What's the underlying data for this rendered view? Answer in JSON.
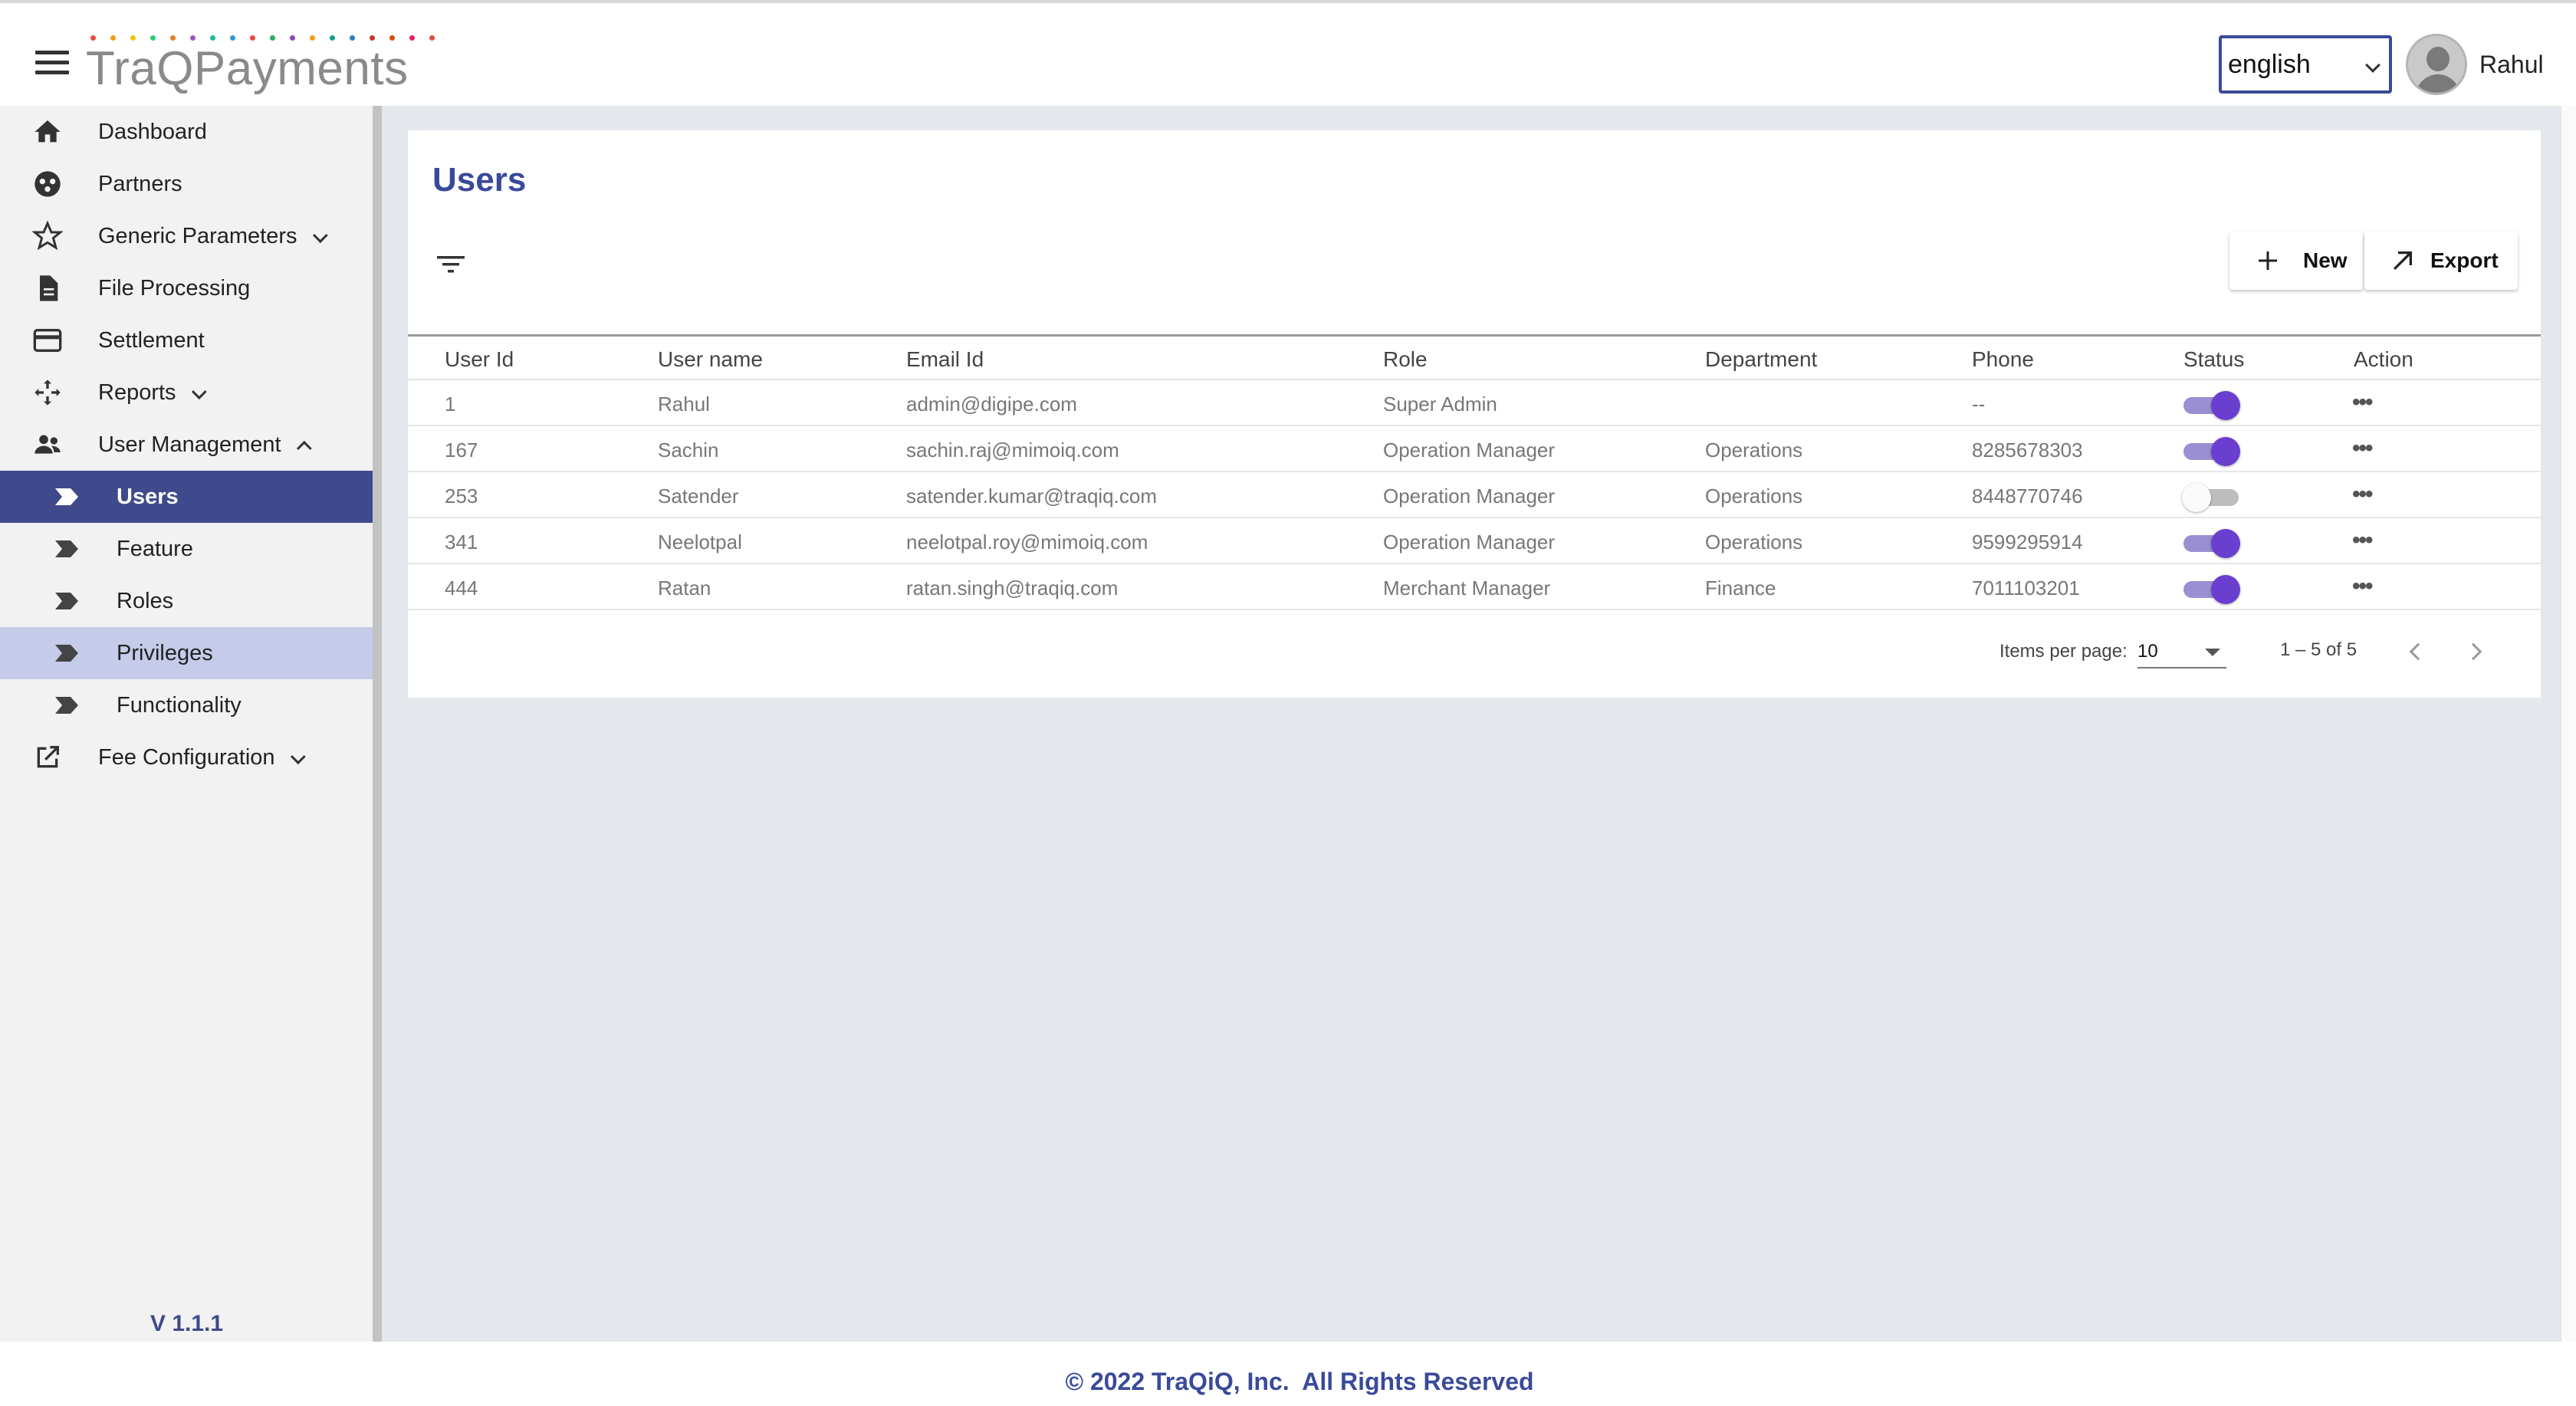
{
  "header": {
    "logo_text": "TraQPayments",
    "language": "english",
    "user_name": "Rahul"
  },
  "sidebar": {
    "items": [
      {
        "label": "Dashboard"
      },
      {
        "label": "Partners"
      },
      {
        "label": "Generic Parameters"
      },
      {
        "label": "File Processing"
      },
      {
        "label": "Settlement"
      },
      {
        "label": "Reports"
      },
      {
        "label": "User Management"
      },
      {
        "label": "Users"
      },
      {
        "label": "Feature"
      },
      {
        "label": "Roles"
      },
      {
        "label": "Privileges"
      },
      {
        "label": "Functionality"
      },
      {
        "label": "Fee Configuration"
      }
    ],
    "version": "V 1.1.1"
  },
  "main": {
    "title": "Users",
    "new_label": "New",
    "export_label": "Export",
    "columns": [
      "User Id",
      "User name",
      "Email Id",
      "Role",
      "Department",
      "Phone",
      "Status",
      "Action"
    ],
    "rows": [
      {
        "id": "1",
        "name": "Rahul",
        "email": "admin@digipe.com",
        "role": "Super Admin",
        "department": "",
        "phone": "--",
        "status": true,
        "action": "•••"
      },
      {
        "id": "167",
        "name": "Sachin",
        "email": "sachin.raj@mimoiq.com",
        "role": "Operation Manager",
        "department": "Operations",
        "phone": "8285678303",
        "status": true,
        "action": "•••"
      },
      {
        "id": "253",
        "name": "Satender",
        "email": "satender.kumar@traqiq.com",
        "role": "Operation Manager",
        "department": "Operations",
        "phone": "8448770746",
        "status": false,
        "action": "•••"
      },
      {
        "id": "341",
        "name": "Neelotpal",
        "email": "neelotpal.roy@mimoiq.com",
        "role": "Operation Manager",
        "department": "Operations",
        "phone": "9599295914",
        "status": true,
        "action": "•••"
      },
      {
        "id": "444",
        "name": "Ratan",
        "email": "ratan.singh@traqiq.com",
        "role": "Merchant Manager",
        "department": "Finance",
        "phone": "7011103201",
        "status": true,
        "action": "•••"
      }
    ],
    "paginator": {
      "items_per_page_label": "Items per page:",
      "items_per_page": "10",
      "range": "1 – 5 of 5"
    }
  },
  "footer": {
    "text": "© 2022 TraQiQ, Inc.  All Rights Reserved"
  },
  "colors": {
    "primary": "#3f4a8c",
    "toggle_on": "#6a3fd0",
    "hover": "#c5cbe9"
  },
  "icons": [
    "menu-icon",
    "home-icon",
    "partners-icon",
    "star-icon",
    "file-icon",
    "card-icon",
    "reports-icon",
    "people-icon",
    "arrow-tag-icon",
    "external-link-icon",
    "filter-icon",
    "plus-icon",
    "arrow-up-right-icon",
    "chevron-left-icon",
    "chevron-right-icon"
  ]
}
